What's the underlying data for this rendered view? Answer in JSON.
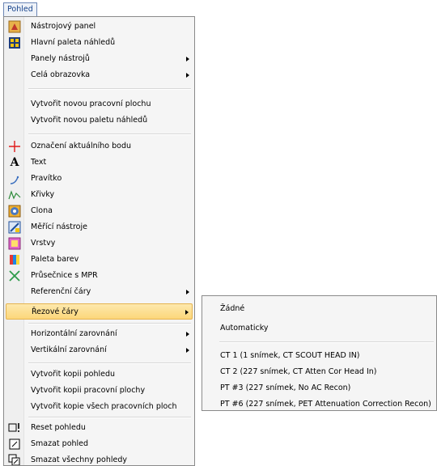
{
  "menubar": {
    "pohled": "Pohled"
  },
  "menu": {
    "nastrojovy_panel": "Nástrojový panel",
    "hlavni_paleta": "Hlavní paleta náhledů",
    "panely_nastroju": "Panely nástrojů",
    "cela_obrazovka": "Celá obrazovka",
    "vytvorit_plochu": "Vytvořit novou pracovní plochu",
    "vytvorit_paletu": "Vytvořit novou paletu náhledů",
    "oznaceni_bodu": "Označení aktuálního bodu",
    "text": "Text",
    "pravitko": "Pravítko",
    "krivky": "Křivky",
    "clona": "Clona",
    "merici_nastroje": "Měřící nástroje",
    "vrstvy": "Vrstvy",
    "paleta_barev": "Paleta barev",
    "prusecnice": "Průsečnice s MPR",
    "referencni_cary": "Referenční čáry",
    "rezove_cary": "Řezové čáry",
    "horizontalni": "Horizontální zarovnání",
    "vertikalni": "Vertikální zarovnání",
    "kopie_pohledu": "Vytvořit kopii pohledu",
    "kopie_plochy": "Vytvořit kopii pracovní plochy",
    "kopie_vsech": "Vytvořit kopie všech pracovních ploch",
    "reset": "Reset pohledu",
    "smazat": "Smazat pohled",
    "smazat_vsechny": "Smazat všechny pohledy"
  },
  "submenu": {
    "zadne": "Žádné",
    "automaticky": "Automaticky",
    "ct1": "CT 1 (1 snímek, CT SCOUT HEAD IN)",
    "ct2": "CT 2 (227 snímek, CT Atten Cor Head In)",
    "pt3": "PT #3 (227 snímek, No AC Recon)",
    "pt6": "PT #6 (227 snímek, PET Attenuation Correction Recon)",
    "check": "✓"
  }
}
